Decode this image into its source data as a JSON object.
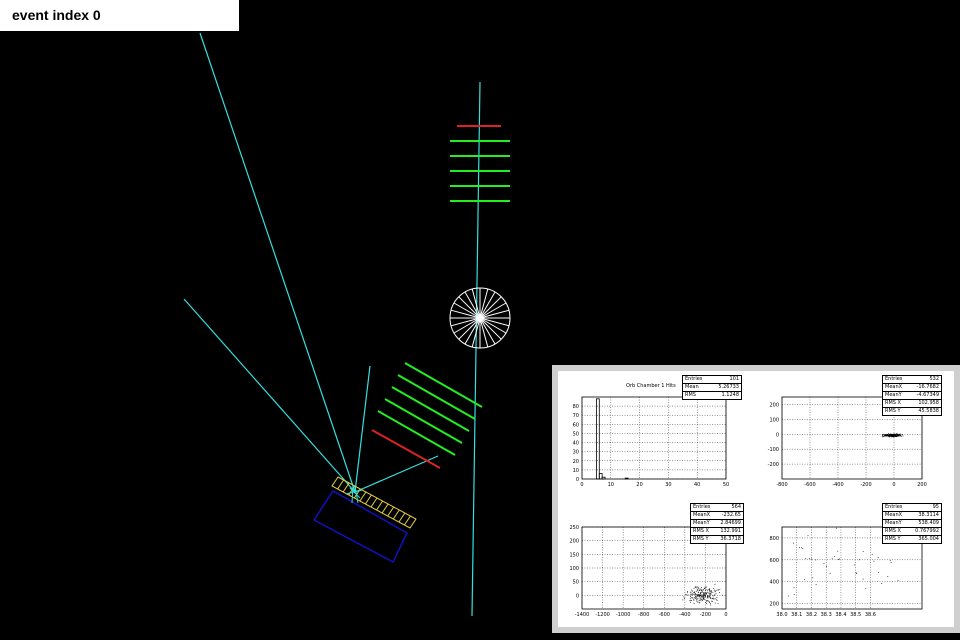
{
  "header": {
    "title": "event index 0"
  },
  "colors": {
    "background": "#000000",
    "track": "#33e0e0",
    "layer_green": "#22ee22",
    "layer_red": "#dd2222",
    "calorimeter_yellow": "#e8d040",
    "box_blue": "#1010c0",
    "target_white": "#ffffff"
  },
  "plots": {
    "p1": {
      "title": "Orb Chamber 1 Hits",
      "stats": [
        {
          "label": "Entries",
          "value": "101"
        },
        {
          "label": "Mean",
          "value": "5.26733"
        },
        {
          "label": "RMS",
          "value": "1.1248"
        }
      ]
    },
    "p2": {
      "stats": [
        {
          "label": "Entries",
          "value": "532"
        },
        {
          "label": "MeanX",
          "value": "-16.7682"
        },
        {
          "label": "MeanY",
          "value": "-4.67349"
        },
        {
          "label": "RMS X",
          "value": "102.958"
        },
        {
          "label": "RMS Y",
          "value": "45.5838"
        }
      ]
    },
    "p3": {
      "stats": [
        {
          "label": "Entries",
          "value": "564"
        },
        {
          "label": "MeanX",
          "value": "-232.65"
        },
        {
          "label": "MeanY",
          "value": "2.84699"
        },
        {
          "label": "RMS X",
          "value": "132.991"
        },
        {
          "label": "RMS Y",
          "value": "36.3718"
        }
      ]
    },
    "p4": {
      "stats": [
        {
          "label": "Entries",
          "value": "95"
        },
        {
          "label": "MeanX",
          "value": "38.3114"
        },
        {
          "label": "MeanY",
          "value": "538.409"
        },
        {
          "label": "RMS X",
          "value": "0.767992"
        },
        {
          "label": "RMS Y",
          "value": "365.004"
        }
      ]
    }
  },
  "chart_data": [
    {
      "type": "bar",
      "title": "Orb Chamber 1 Hits",
      "xlim": [
        0,
        50
      ],
      "ylim": [
        0,
        90
      ],
      "x_ticks": [
        "0",
        "10",
        "20",
        "30",
        "40",
        "50"
      ],
      "y_ticks": [
        "0",
        "10",
        "20",
        "30",
        "40",
        "50",
        "60",
        "70",
        "80"
      ],
      "bins": [
        {
          "x": 5,
          "count": 88
        },
        {
          "x": 6,
          "count": 6
        },
        {
          "x": 7,
          "count": 2
        },
        {
          "x": 15,
          "count": 1
        }
      ]
    },
    {
      "type": "scatter",
      "xlim": [
        -800,
        200
      ],
      "ylim": [
        -300,
        250
      ],
      "x_ticks": [
        "-800",
        "-600",
        "-400",
        "-200",
        "0",
        "200"
      ],
      "y_ticks": [
        "-200",
        "-100",
        "0",
        "100",
        "200"
      ],
      "cluster": {
        "mean_x": -16.8,
        "mean_y": -4.7,
        "rms_x": 30,
        "rms_y": 5
      }
    },
    {
      "type": "scatter",
      "xlim": [
        -1400,
        0
      ],
      "ylim": [
        -50,
        250
      ],
      "x_ticks": [
        "-1400",
        "-1200",
        "-1000",
        "-800",
        "-600",
        "-400",
        "-200",
        "0"
      ],
      "y_ticks": [
        "0",
        "50",
        "100",
        "150",
        "200",
        "250"
      ],
      "cluster": {
        "mean_x": -232.65,
        "mean_y": 2.8,
        "rms_x": 80,
        "rms_y": 15
      }
    },
    {
      "type": "scatter",
      "xlim": [
        38.0,
        38.95
      ],
      "ylim": [
        150,
        900
      ],
      "x_ticks": [
        "38.0",
        "38.1",
        "38.2",
        "38.3",
        "38.4",
        "38.5",
        "38.6"
      ],
      "y_ticks": [
        "200",
        "400",
        "600",
        "800"
      ],
      "cluster": {
        "mean_x": 38.31,
        "mean_y": 538.4,
        "rms_x": 0.3,
        "rms_y": 250
      }
    }
  ]
}
